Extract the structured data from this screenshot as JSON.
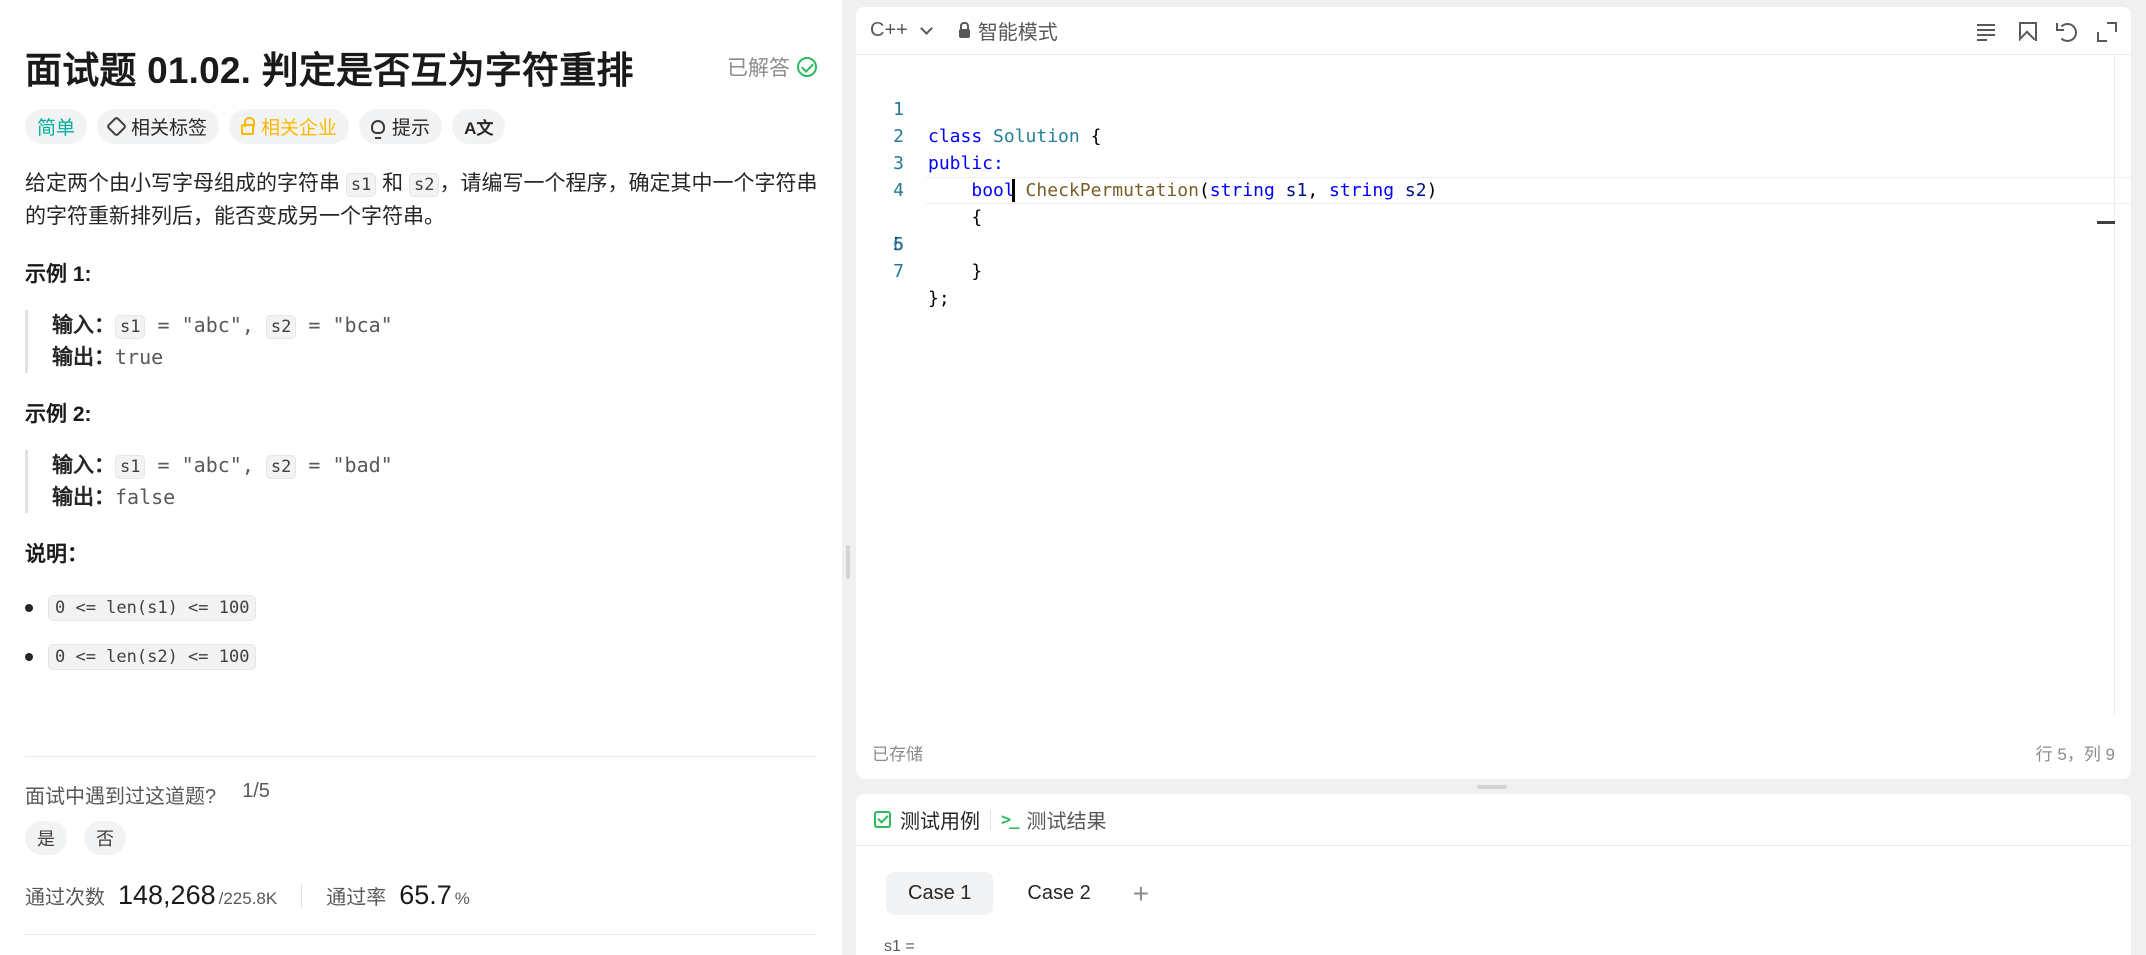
{
  "problem": {
    "title": "面试题 01.02. 判定是否互为字符重排",
    "solved_label": "已解答",
    "tags": {
      "difficulty": "简单",
      "topics": "相关标签",
      "companies": "相关企业",
      "hint": "提示",
      "translate_glyph": "A文"
    },
    "desc": {
      "p1": "给定两个由小写字母组成的字符串 ",
      "c1": "s1",
      "p2": " 和 ",
      "c2": "s2",
      "p3": "，请编写一个程序，确定其中一个字符串的字符重新排列后，能否变成另一个字符串。"
    },
    "example1": {
      "title": "示例 1:",
      "input_label": "输入：",
      "s1": "s1",
      "eq1": " = \"abc\", ",
      "s2": "s2",
      "eq2": " = \"bca\"",
      "output_label": "输出：",
      "output": "true"
    },
    "example2": {
      "title": "示例 2:",
      "input_label": "输入：",
      "s1": "s1",
      "eq1": " = \"abc\", ",
      "s2": "s2",
      "eq2": " = \"bad\"",
      "output_label": "输出：",
      "output": "false"
    },
    "notes_title": "说明：",
    "constraints": [
      "0 <= len(s1) <= 100",
      "0 <= len(s2) <= 100"
    ],
    "encountered": {
      "question": "面试中遇到过这道题?",
      "count": "1/5",
      "yes": "是",
      "no": "否"
    },
    "stats": {
      "accepted_label": "通过次数",
      "accepted": "148,268",
      "submissions": "/225.8K",
      "rate_label": "通过率",
      "rate": "65.7",
      "rate_unit": "%"
    }
  },
  "editor": {
    "language": "C++",
    "mode": "智能模式",
    "lines": [
      {
        "n": "1"
      },
      {
        "n": "2"
      },
      {
        "n": "3"
      },
      {
        "n": "4"
      },
      {
        "n": "5"
      },
      {
        "n": "6"
      },
      {
        "n": "7"
      }
    ],
    "code": {
      "l1_kw": "class",
      "l1_name": " Solution",
      "l1_rest": " {",
      "l2": "public:",
      "l3_indent": "    ",
      "l3_kw": "bool",
      "l3_fn": " CheckPermutation",
      "l3_p1": "(",
      "l3_t1": "string",
      "l3_v1": " s1",
      "l3_c": ", ",
      "l3_t2": "string",
      "l3_v2": " s2",
      "l3_p2": ")",
      "l4": "    {",
      "l5": "        ",
      "l6": "    }",
      "l7": "};"
    },
    "status_saved": "已存储",
    "status_pos": "行 5，列 9"
  },
  "tests": {
    "tab_cases": "测试用例",
    "tab_result": "测试结果",
    "term_glyph": ">_",
    "cases": [
      "Case 1",
      "Case 2"
    ],
    "add": "+",
    "s1_label": "s1 ="
  },
  "colors": {
    "easy": "#00af9b",
    "locked": "#ffb800",
    "success": "#2cbb5d",
    "keyword": "#0000ff",
    "type": "#267f99",
    "function": "#795e26",
    "line_number": "#237893"
  }
}
